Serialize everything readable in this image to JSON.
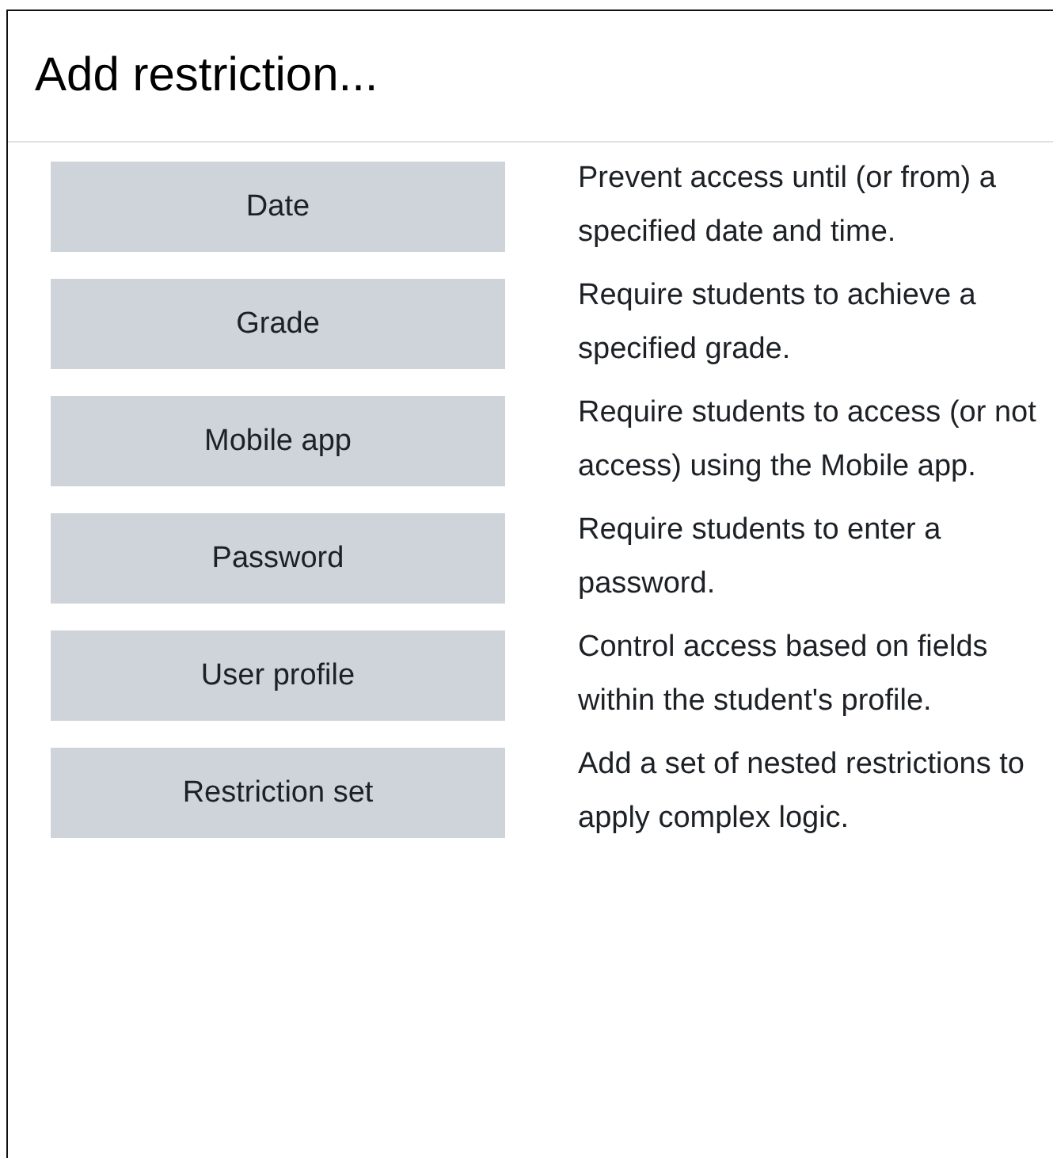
{
  "title": "Add restriction...",
  "options": [
    {
      "label": "Date",
      "description": "Prevent access until (or from) a specified date and time."
    },
    {
      "label": "Grade",
      "description": "Require students to achieve a specified grade."
    },
    {
      "label": "Mobile app",
      "description": "Require students to access (or not access) using the Mobile app."
    },
    {
      "label": "Password",
      "description": "Require students to enter a password."
    },
    {
      "label": "User profile",
      "description": "Control access based on fields within the student's profile."
    },
    {
      "label": "Restriction set",
      "description": "Add a set of nested restrictions to apply complex logic."
    }
  ]
}
